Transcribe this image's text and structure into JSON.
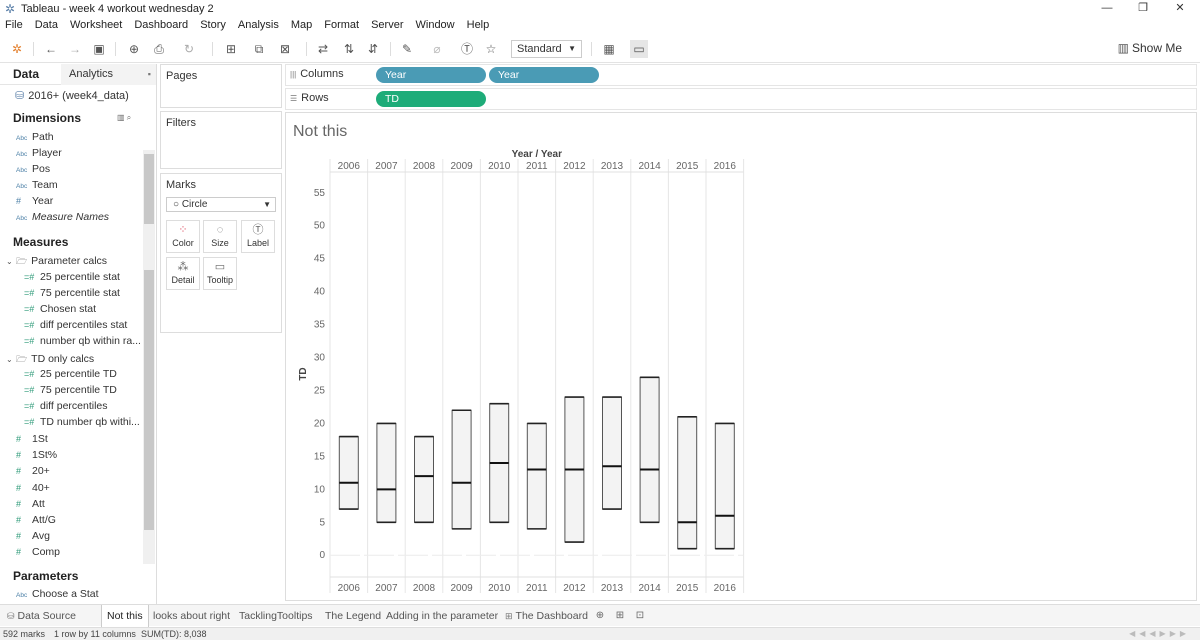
{
  "window": {
    "title": "Tableau - week 4 workout wednesday 2"
  },
  "menu": [
    "File",
    "Data",
    "Worksheet",
    "Dashboard",
    "Story",
    "Analysis",
    "Map",
    "Format",
    "Server",
    "Window",
    "Help"
  ],
  "toolbar": {
    "fit_select": "Standard",
    "show_me": "Show Me"
  },
  "data_pane": {
    "tab_data": "Data",
    "tab_analytics": "Analytics",
    "datasource": "2016+ (week4_data)",
    "dimensions_header": "Dimensions",
    "dimensions": [
      {
        "label": "Path",
        "type": "Abc"
      },
      {
        "label": "Player",
        "type": "Abc"
      },
      {
        "label": "Pos",
        "type": "Abc"
      },
      {
        "label": "Team",
        "type": "Abc"
      },
      {
        "label": "Year",
        "type": "#"
      },
      {
        "label": "Measure Names",
        "type": "Abc"
      }
    ],
    "measures_header": "Measures",
    "folder1": "Parameter calcs",
    "folder1_items": [
      "25 percentile stat",
      "75 percentile stat",
      "Chosen stat",
      "diff percentiles stat",
      "number qb within ra..."
    ],
    "folder2": "TD only calcs",
    "folder2_items": [
      "25 percentile TD",
      "75 percentile TD",
      "diff percentiles",
      "TD number qb withi..."
    ],
    "measures": [
      "1St",
      "1St%",
      "20+",
      "40+",
      "Att",
      "Att/G",
      "Avg",
      "Comp"
    ],
    "parameters_header": "Parameters",
    "parameters": [
      {
        "label": "Choose a Stat",
        "type": "Abc"
      }
    ]
  },
  "cards": {
    "pages": "Pages",
    "filters": "Filters",
    "marks": "Marks",
    "mark_type": "Circle",
    "mark_buttons": [
      "Color",
      "Size",
      "Label",
      "Detail",
      "Tooltip"
    ]
  },
  "shelves": {
    "columns_label": "Columns",
    "rows_label": "Rows",
    "columns_pills": [
      "Year",
      "Year"
    ],
    "rows_pills": [
      "TD"
    ]
  },
  "sheet": {
    "title": "Not this"
  },
  "chart_data": {
    "type": "bar",
    "title": "Not this",
    "xlabel": "Year / Year",
    "ylabel": "TD",
    "categories": [
      "2006",
      "2007",
      "2008",
      "2009",
      "2010",
      "2011",
      "2012",
      "2013",
      "2014",
      "2015",
      "2016"
    ],
    "y_ticks": [
      0,
      5,
      10,
      15,
      20,
      25,
      30,
      35,
      40,
      45,
      50,
      55
    ],
    "ylim": [
      -3,
      58
    ],
    "series": [
      {
        "low": [
          7,
          5,
          5,
          4,
          5,
          4,
          2,
          7,
          5,
          1,
          1
        ],
        "median": [
          11,
          10,
          12,
          11,
          14,
          13,
          13,
          13.5,
          13,
          5,
          6
        ],
        "high": [
          18,
          20,
          18,
          22,
          23,
          20,
          24,
          24,
          27,
          21,
          20
        ]
      }
    ],
    "grid": true
  },
  "bottom_tabs": [
    "Data Source",
    "Not this",
    "looks about right",
    "TacklingTooltips",
    "The Legend",
    "Adding in the parameter",
    "The Dashboard"
  ],
  "status": {
    "marks": "592 marks",
    "rows": "1 row by 11 columns",
    "sum": "SUM(TD): 8,038"
  }
}
